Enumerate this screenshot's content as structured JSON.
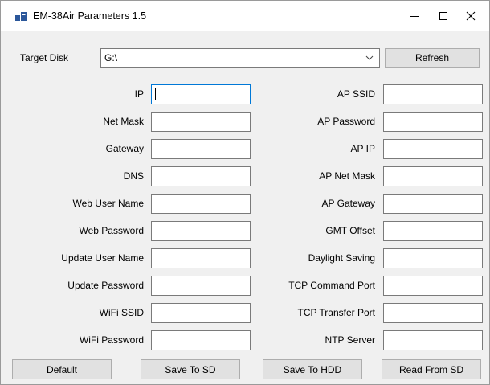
{
  "window": {
    "title": "EM-38Air Parameters 1.5"
  },
  "target_disk": {
    "label": "Target Disk",
    "value": "G:\\",
    "refresh_label": "Refresh"
  },
  "left_fields": [
    {
      "label": "IP",
      "value": ""
    },
    {
      "label": "Net Mask",
      "value": ""
    },
    {
      "label": "Gateway",
      "value": ""
    },
    {
      "label": "DNS",
      "value": ""
    },
    {
      "label": "Web User Name",
      "value": ""
    },
    {
      "label": "Web Password",
      "value": ""
    },
    {
      "label": "Update User Name",
      "value": ""
    },
    {
      "label": "Update Password",
      "value": ""
    },
    {
      "label": "WiFi SSID",
      "value": ""
    },
    {
      "label": "WiFi Password",
      "value": ""
    }
  ],
  "right_fields": [
    {
      "label": "AP SSID",
      "value": ""
    },
    {
      "label": "AP Password",
      "value": ""
    },
    {
      "label": "AP IP",
      "value": ""
    },
    {
      "label": "AP Net Mask",
      "value": ""
    },
    {
      "label": "AP Gateway",
      "value": ""
    },
    {
      "label": "GMT Offset",
      "value": ""
    },
    {
      "label": "Daylight Saving",
      "value": ""
    },
    {
      "label": "TCP Command Port",
      "value": ""
    },
    {
      "label": "TCP Transfer Port",
      "value": ""
    },
    {
      "label": "NTP Server",
      "value": ""
    }
  ],
  "buttons": {
    "default": "Default",
    "save_sd": "Save To SD",
    "save_hdd": "Save To HDD",
    "read_sd": "Read From SD"
  }
}
